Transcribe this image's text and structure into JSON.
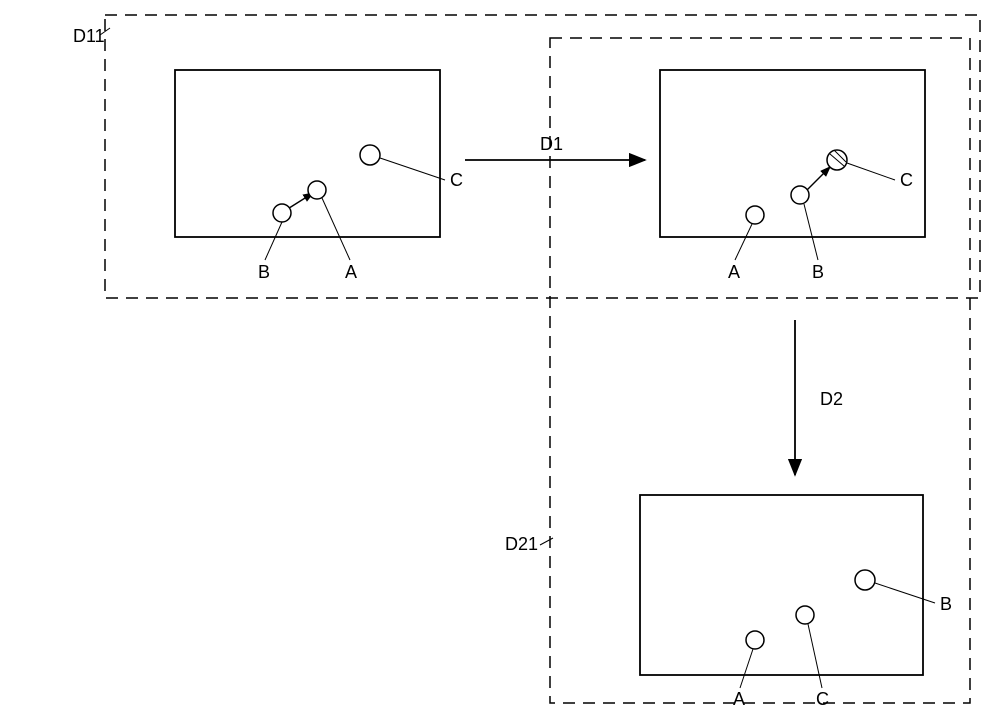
{
  "labels": {
    "outer_dashed": "D11",
    "inner_dashed": "D21",
    "arrow_right": "D1",
    "arrow_down": "D2",
    "panel1": {
      "nodeA": "A",
      "nodeB": "B",
      "nodeC": "C"
    },
    "panel2": {
      "nodeA": "A",
      "nodeB": "B",
      "nodeC": "C"
    },
    "panel3": {
      "nodeA": "A",
      "nodeB": "B",
      "nodeC": "C"
    }
  },
  "geometry": {
    "note": "approximate positions read from image; circles A,B,C with leader lines in each panel; D1 horizontal arrow between top panels; D2 vertical arrow from top-right to bottom panel; D11 outer dashed frame; D21 inner dashed frame enclosing right top + bottom panel"
  }
}
